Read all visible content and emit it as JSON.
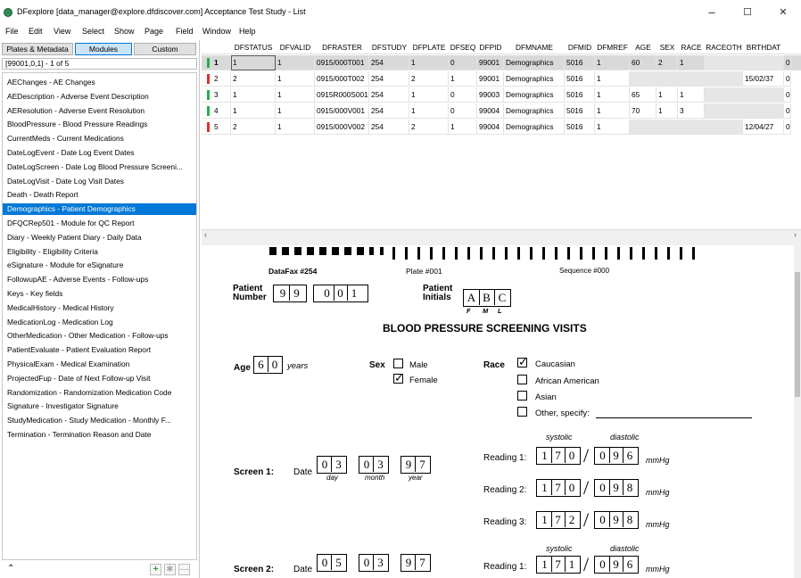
{
  "window": {
    "title": "DFexplore [data_manager@explore.dfdiscover.com] Acceptance Test Study - List",
    "min": "–",
    "max": "☐",
    "close": "✕"
  },
  "menu": [
    "File",
    "Edit",
    "View",
    "Select",
    "Show",
    "Page",
    "Field",
    "Window",
    "Help"
  ],
  "left": {
    "tabs": [
      "Plates & Metadata",
      "Modules",
      "Custom"
    ],
    "keyrange": "[99001,0,1] - 1 of 5",
    "modules": [
      "AEChanges - AE Changes",
      "AEDescription - Adverse Event Description",
      "AEResolution - Adverse Event Resolution",
      "BloodPressure - Blood Pressure Readings",
      "CurrentMeds - Current Medications",
      "DateLogEvent - Date Log Event Dates",
      "DateLogScreen - Date Log Blood Pressure Screeni...",
      "DateLogVisit - Date Log Visit Dates",
      "Death - Death Report",
      "Demographics - Patient Demographics",
      "DFQCRep501 - Module for QC Report",
      "Diary - Weekly Patient Diary - Daily Data",
      "Eligibility - Eligibility Criteria",
      "eSignature - Module for eSignature",
      "FollowupAE - Adverse Events - Follow-ups",
      "Keys - Key fields",
      "MedicalHistory - Medical History",
      "MedicationLog - Medication Log",
      "OtherMedication - Other Medication - Follow-ups",
      "PatientEvaluate - Patient Evaluation Report",
      "PhysicalExam - Medical Examination",
      "ProjectedFup - Date of Next Follow-up Visit",
      "Randomization - Randomization Medication Code",
      "Signature - Investigator Signature",
      "StudyMedication - Study Medication - Monthly F...",
      "Termination - Termination Reason and Date"
    ],
    "selected_index": 9,
    "bottom": {
      "up": "⌃",
      "add": "+",
      "star": "✱",
      "minus": "—"
    }
  },
  "grid": {
    "headers": [
      "",
      "DFSTATUS",
      "DFVALID",
      "DFRASTER",
      "DFSTUDY",
      "DFPLATE",
      "DFSEQ",
      "DFPID",
      "DFMNAME",
      "DFMID",
      "DFMREF",
      "AGE",
      "SEX",
      "RACE",
      "RACEOTH",
      "BRTHDAT",
      ""
    ],
    "rows": [
      {
        "n": "1",
        "status_color": "#22b14c",
        "cells": [
          "1",
          "1",
          "0915/000T001",
          "254",
          "1",
          "0",
          "99001",
          "Demographics",
          "5016",
          "1",
          "60",
          "2",
          "1",
          "",
          "",
          "0"
        ]
      },
      {
        "n": "2",
        "status_color": "#e03030",
        "cells": [
          "2",
          "1",
          "0915/000T002",
          "254",
          "2",
          "1",
          "99001",
          "Demographics",
          "5016",
          "1",
          "",
          "",
          "",
          "",
          "15/02/37",
          "0"
        ]
      },
      {
        "n": "3",
        "status_color": "#22b14c",
        "cells": [
          "1",
          "1",
          "0915R000S001",
          "254",
          "1",
          "0",
          "99003",
          "Demographics",
          "5016",
          "1",
          "65",
          "1",
          "1",
          "",
          "",
          "0"
        ]
      },
      {
        "n": "4",
        "status_color": "#22b14c",
        "cells": [
          "1",
          "1",
          "0915/000V001",
          "254",
          "1",
          "0",
          "99004",
          "Demographics",
          "5016",
          "1",
          "70",
          "1",
          "3",
          "",
          "",
          "0"
        ]
      },
      {
        "n": "5",
        "status_color": "#e03030",
        "cells": [
          "2",
          "1",
          "0915/000V002",
          "254",
          "2",
          "1",
          "99004",
          "Demographics",
          "5016",
          "1",
          "",
          "",
          "",
          "",
          "12/04/27",
          "0"
        ]
      }
    ]
  },
  "form": {
    "datafax": "DataFax #254",
    "plate": "Plate #001",
    "sequence": "Sequence #000",
    "patient_number_label": "Patient Number",
    "patient_number": [
      "9",
      "9",
      "0",
      "0",
      "1"
    ],
    "patient_initials_label": "Patient Initials",
    "initials": [
      "A",
      "B",
      "C"
    ],
    "initials_sub": [
      "F",
      "M",
      "L"
    ],
    "heading": "BLOOD PRESSURE SCREENING VISITS",
    "age_label": "Age",
    "age": [
      "6",
      "0"
    ],
    "years": "years",
    "sex_label": "Sex",
    "male": "Male",
    "female": "Female",
    "race_label": "Race",
    "caucasian": "Caucasian",
    "african_american": "African American",
    "asian": "Asian",
    "other": "Other, specify:",
    "systolic": "systolic",
    "diastolic": "diastolic",
    "mmhg": "mmHg",
    "screen1_label": "Screen 1:",
    "screen2_label": "Screen 2:",
    "date_label": "Date",
    "day": "day",
    "month": "month",
    "year": "year",
    "s1_date": [
      [
        "0",
        "3"
      ],
      [
        "0",
        "3"
      ],
      [
        "9",
        "7"
      ]
    ],
    "s2_date": [
      [
        "0",
        "5"
      ],
      [
        "0",
        "3"
      ],
      [
        "9",
        "7"
      ]
    ],
    "readings": [
      {
        "label": "Reading 1:",
        "sys": [
          "1",
          "7",
          "0"
        ],
        "dia": [
          "0",
          "9",
          "6"
        ]
      },
      {
        "label": "Reading 2:",
        "sys": [
          "1",
          "7",
          "0"
        ],
        "dia": [
          "0",
          "9",
          "8"
        ]
      },
      {
        "label": "Reading 3:",
        "sys": [
          "1",
          "7",
          "2"
        ],
        "dia": [
          "0",
          "9",
          "8"
        ]
      }
    ],
    "s2_reading1": {
      "label": "Reading 1:",
      "sys": [
        "1",
        "7",
        "1"
      ],
      "dia": [
        "0",
        "9",
        "6"
      ]
    }
  }
}
